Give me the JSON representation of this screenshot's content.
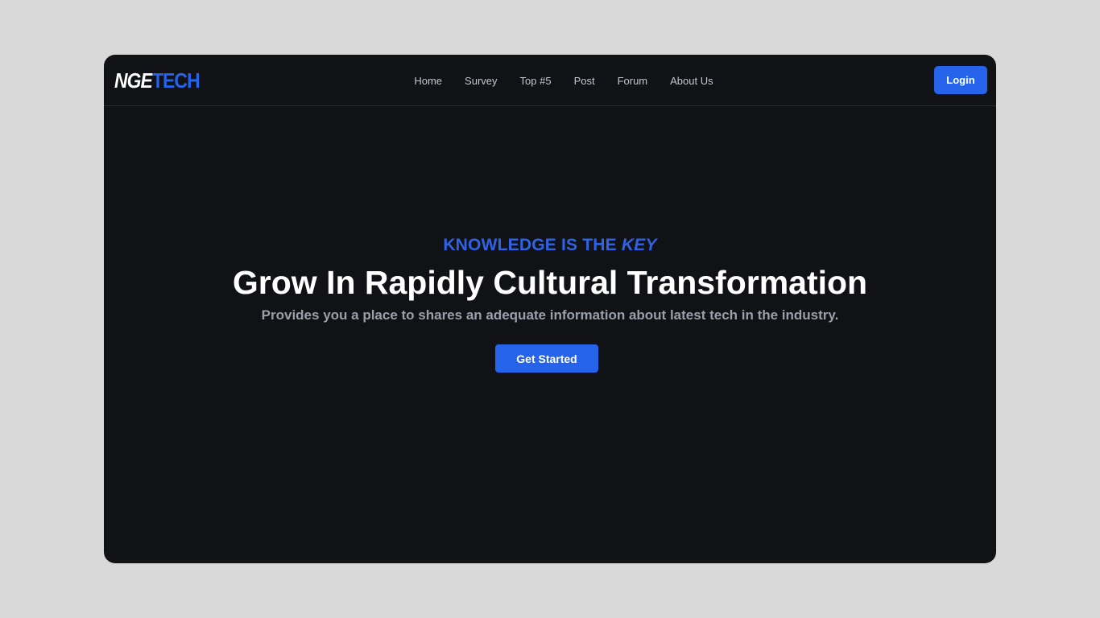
{
  "logo": {
    "part1": "NGE",
    "part2": "TECH"
  },
  "nav": {
    "links": [
      "Home",
      "Survey",
      "Top #5",
      "Post",
      "Forum",
      "About Us"
    ],
    "login_label": "Login"
  },
  "hero": {
    "eyebrow_main": "KNOWLEDGE IS THE ",
    "eyebrow_emphasis": "KEY",
    "headline": "Grow In Rapidly Cultural Transformation",
    "subtitle": "Provides you a place to shares an adequate information about latest tech in the industry.",
    "cta_label": "Get Started"
  },
  "colors": {
    "page_background": "#d9d9d9",
    "window_background": "#111216",
    "accent": "#2563eb",
    "headline": "#ffffff",
    "subtitle": "#9aa0ab"
  }
}
